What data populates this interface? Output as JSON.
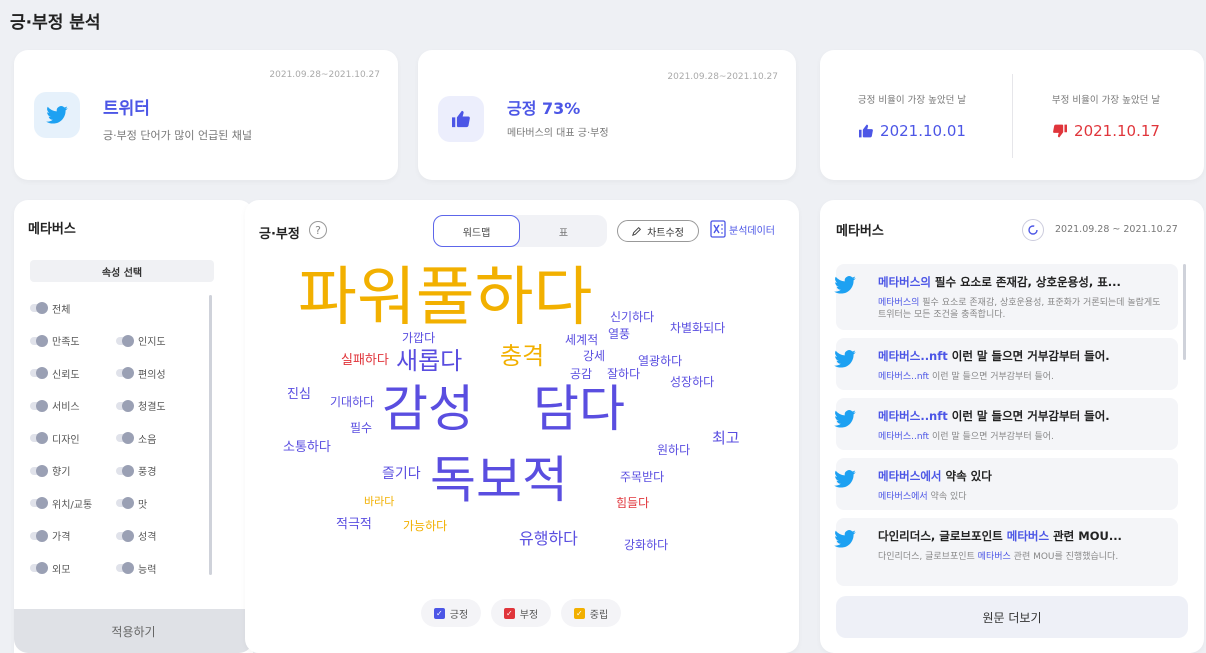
{
  "page_title": "긍·부정 분석",
  "colors": {
    "accent": "#4c56e6",
    "positive": "#5a4ee0",
    "negative": "#e0353b",
    "neutral": "#f2b000",
    "twitter": "#1da1f2"
  },
  "top_cards": {
    "channel": {
      "range": "2021.09.28~2021.10.27",
      "icon": "twitter-icon",
      "title": "트위터",
      "subtitle": "긍·부정 단어가 많이 언급된 채널"
    },
    "sentiment": {
      "range": "2021.09.28~2021.10.27",
      "icon": "thumbs-up-icon",
      "title": "긍정 73%",
      "subtitle": "메타버스의 대표 긍·부정"
    },
    "peaks": {
      "positive_label": "긍정 비율이 가장 높았던 날",
      "positive_date": "2021.10.01",
      "negative_label": "부정 비율이 가장 높았던 날",
      "negative_date": "2021.10.17"
    }
  },
  "left_panel": {
    "title": "메타버스",
    "attr_header": "속성 선택",
    "attrs": {
      "a0": "전체",
      "a1": "만족도",
      "a2": "인지도",
      "a3": "신뢰도",
      "a4": "편의성",
      "a5": "서비스",
      "a6": "청결도",
      "a7": "디자인",
      "a8": "소음",
      "a9": "향기",
      "a10": "풍경",
      "a11": "위치/교통",
      "a12": "맛",
      "a13": "가격",
      "a14": "성격",
      "a15": "외모",
      "a16": "능력"
    },
    "apply": "적용하기"
  },
  "center_panel": {
    "title": "긍·부정",
    "help": "?",
    "tab_wordmap": "워드맵",
    "tab_table": "표",
    "edit_chart": "차트수정",
    "export": "분석데이터",
    "legend_pos": "긍정",
    "legend_neg": "부정",
    "legend_neu": "중립"
  },
  "words": {
    "w1": "파워풀하다",
    "w2": "신기하다",
    "w3": "열풍",
    "w4": "차별화되다",
    "w5": "가깝다",
    "w6": "세계적",
    "w7": "실패하다",
    "w8": "새롭다",
    "w9": "충격",
    "w10": "강세",
    "w11": "열광하다",
    "w12": "공감",
    "w13": "잘하다",
    "w14": "성장하다",
    "w15": "진심",
    "w16": "기대하다",
    "w17": "감성",
    "w18": "담다",
    "w19": "필수",
    "w20": "소통하다",
    "w21": "원하다",
    "w22": "최고",
    "w23": "즐기다",
    "w24": "독보적",
    "w25": "주목받다",
    "w26": "바라다",
    "w27": "힘들다",
    "w28": "적극적",
    "w29": "가능하다",
    "w30": "유행하다",
    "w31": "강화하다"
  },
  "right_panel": {
    "title": "메타버스",
    "range": "2021.09.28 ~ 2021.10.27",
    "more": "원문 더보기",
    "feed": {
      "i1": {
        "title_hl": "메타버스의",
        "title_rest": " 필수 요소로 존재감, 상호운용성, 표...",
        "desc_hl": "메타버스의",
        "desc_rest": " 필수 요소로 존재감, 상호운용성, 표준화가 거론되는데 놀랍게도 트위터는 모든 조건을 충족합니다."
      },
      "i2": {
        "title_hl": "메타버스..nft",
        "title_rest": " 이런 말 들으면 거부감부터 들어.",
        "desc_hl": "메타버스..nft",
        "desc_rest": " 이런 말 들으면 거부감부터 들어."
      },
      "i3": {
        "title_hl": "메타버스..nft",
        "title_rest": " 이런 말 들으면 거부감부터 들어.",
        "desc_hl": "메타버스..nft",
        "desc_rest": " 이런 말 들으면 거부감부터 들어."
      },
      "i4": {
        "title_hl": "메타버스에서",
        "title_rest": " 약속 있다",
        "desc_hl": "메타버스에서",
        "desc_rest": " 약속 있다"
      },
      "i5": {
        "title_pre": "다인리더스, 글로브포인트 ",
        "title_hl": "메타버스",
        "title_rest": " 관련 MOU...",
        "desc_pre": "다인리더스, 글로브포인트 ",
        "desc_hl": "메타버스",
        "desc_rest": " 관련 MOU를 진행했습니다."
      }
    }
  }
}
